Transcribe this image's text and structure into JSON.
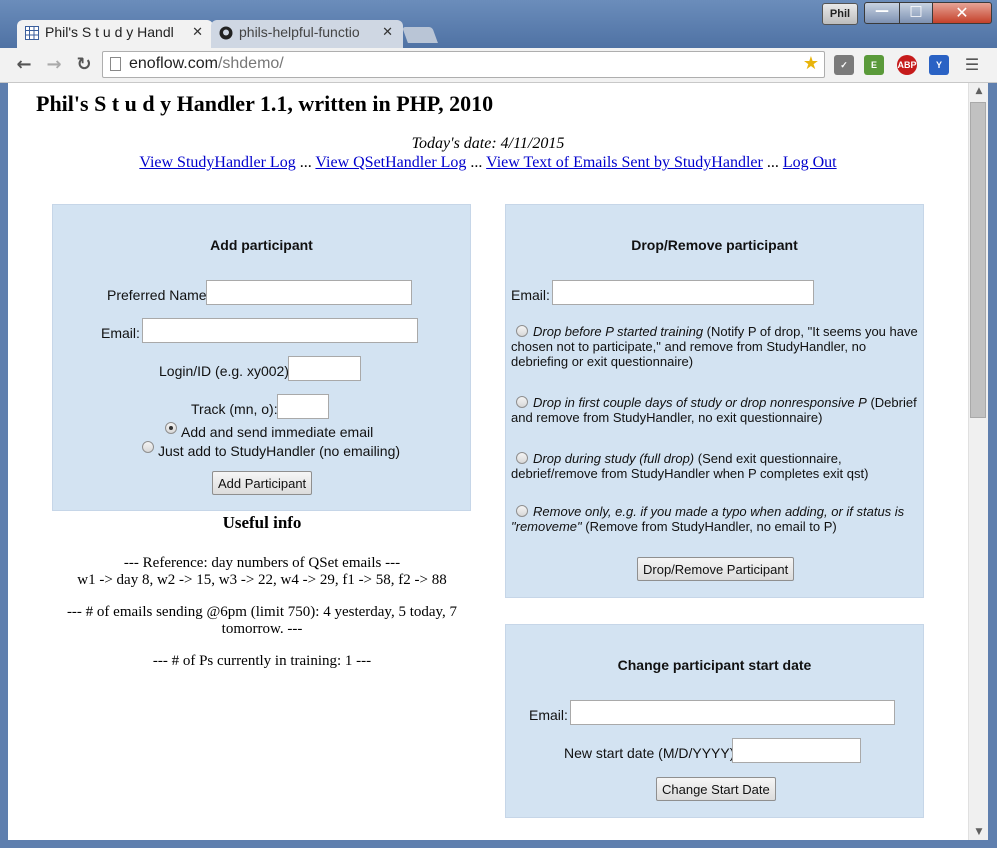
{
  "browser": {
    "profile_name": "Phil",
    "tabs": [
      {
        "title": "Phil's S t u d y Handl",
        "active": true,
        "icon": "grid-favicon-icon"
      },
      {
        "title": "phils-helpful-functio",
        "active": false,
        "icon": "github-icon"
      }
    ],
    "url_host": "enoflow.com",
    "url_path": "/shdemo/",
    "extensions": [
      "pocket-icon",
      "evernote-icon",
      "adblock-plus-icon",
      "yoono-icon"
    ],
    "adblock_label": "ABP"
  },
  "page": {
    "heading": "Phil's S t u d y Handler 1.1, written in PHP, 2010",
    "date_line": "Today's date: 4/11/2015",
    "links": {
      "studyhandler_log": "View StudyHandler Log",
      "qsethandler_log": "View QSetHandler Log",
      "emails_sent": "View Text of Emails Sent by StudyHandler",
      "logout": "Log Out",
      "separator": " ... "
    }
  },
  "add_participant": {
    "title": "Add participant",
    "preferred_name_label": "Preferred Name:",
    "email_label": "Email:",
    "login_label": "Login/ID (e.g. xy002):",
    "track_label": "Track (mn, o):",
    "option_send": "Add and send immediate email",
    "option_just_add": "Just add to StudyHandler (no emailing)",
    "selected_option": "send",
    "button": "Add Participant"
  },
  "drop_participant": {
    "title": "Drop/Remove participant",
    "email_label": "Email:",
    "options": [
      {
        "italic": "Drop before P started training",
        "rest": " (Notify P of drop, \"It seems you have chosen not to participate,\" and remove from StudyHandler, no debriefing or exit questionnaire)"
      },
      {
        "italic": "Drop in first couple days of study or drop nonresponsive P",
        "rest": " (Debrief and remove from StudyHandler, no exit questionnaire)"
      },
      {
        "italic": "Drop during study (full drop)",
        "rest": " (Send exit questionnaire, debrief/remove from StudyHandler when P completes exit qst)"
      },
      {
        "italic": "Remove only, e.g. if you made a typo when adding, or if status is \"removeme\"",
        "rest": " (Remove from StudyHandler, no email to P)"
      }
    ],
    "button": "Drop/Remove Participant"
  },
  "change_start": {
    "title": "Change participant start date",
    "email_label": "Email:",
    "date_label": "New start date (M/D/YYYY):",
    "button": "Change Start Date"
  },
  "useful_info": {
    "title": "Useful info",
    "reference_line1": "--- Reference: day numbers of QSet emails ---",
    "reference_line2": "w1 -> day 8, w2 -> 15, w3 -> 22, w4 -> 29, f1 -> 58, f2 -> 88",
    "emails_sending": "--- # of emails sending @6pm (limit 750): 4 yesterday, 5 today, 7 tomorrow. ---",
    "in_training": "--- # of Ps currently in training: 1 ---"
  },
  "colors": {
    "panel_bg": "#d3e3f2",
    "link": "#0000cc",
    "window_frame": "#5f7fae"
  }
}
